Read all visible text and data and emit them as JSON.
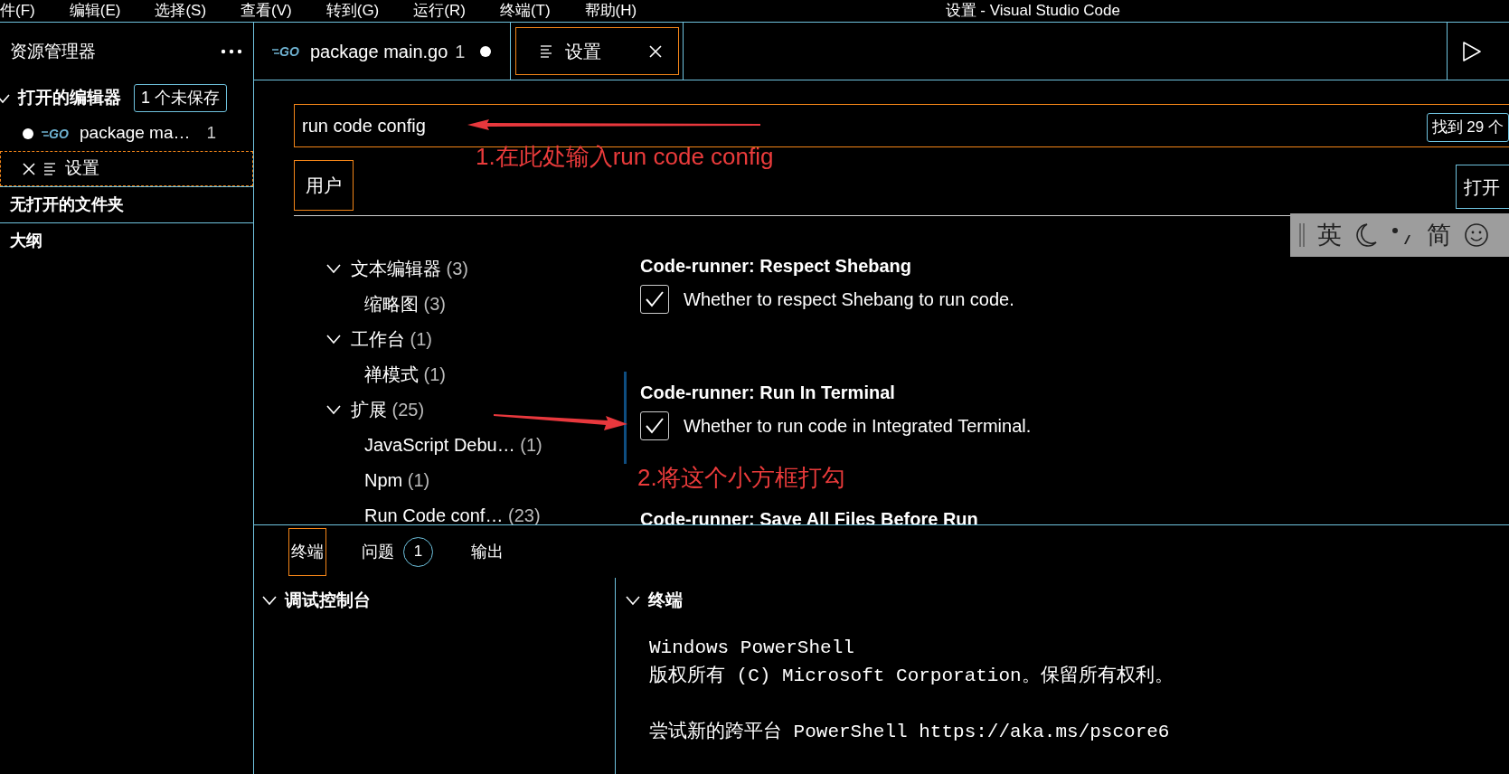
{
  "menu_bar": {
    "items": [
      "件(F)",
      "编辑(E)",
      "选择(S)",
      "查看(V)",
      "转到(G)",
      "运行(R)",
      "终端(T)",
      "帮助(H)"
    ],
    "title": "设置 - Visual Studio Code"
  },
  "sidebar": {
    "title": "资源管理器",
    "open_editors": {
      "label": "打开的编辑器",
      "expanded": true,
      "badge": "1 个未保存",
      "items": [
        {
          "kind": "go",
          "logo": "GO",
          "label": "package ma…",
          "problems": "1",
          "dirty": true,
          "selected": false
        },
        {
          "kind": "settings",
          "label": "设置",
          "dirty": false,
          "selected": true
        }
      ]
    },
    "sections": [
      {
        "label": "无打开的文件夹"
      },
      {
        "label": "大纲"
      }
    ]
  },
  "editor_tabs": [
    {
      "kind": "go",
      "logo": "GO",
      "label": "package main.go",
      "problems": "1",
      "dirty": true,
      "selected": false
    },
    {
      "kind": "settings",
      "label": "设置",
      "dirty": false,
      "selected": true
    }
  ],
  "settings": {
    "search": {
      "value": "run code config",
      "result_count": "找到 29 个"
    },
    "scopes": [
      {
        "label": "用户",
        "selected": true
      }
    ],
    "open_json_button": "打开",
    "toc": [
      {
        "label": "文本编辑器",
        "count": "(3)",
        "expanded": true,
        "children": [
          {
            "label": "缩略图",
            "count": "(3)"
          }
        ]
      },
      {
        "label": "工作台",
        "count": "(1)",
        "expanded": true,
        "children": [
          {
            "label": "禅模式",
            "count": "(1)"
          }
        ]
      },
      {
        "label": "扩展",
        "count": "(25)",
        "expanded": true,
        "children": [
          {
            "label": "JavaScript Debu…",
            "count": "(1)"
          },
          {
            "label": "Npm",
            "count": "(1)"
          },
          {
            "label": "Run Code conf…",
            "count": "(23)"
          }
        ]
      }
    ],
    "items": [
      {
        "category": "Code-runner: ",
        "name": "Respect Shebang",
        "description": "Whether to respect Shebang to run code.",
        "checked": true,
        "focused": false
      },
      {
        "category": "Code-runner: ",
        "name": "Run In Terminal",
        "description": "Whether to run code in Integrated Terminal.",
        "checked": true,
        "focused": true
      },
      {
        "category": "Code-runner: ",
        "name": "Save All Files Before Run",
        "focused": false
      }
    ]
  },
  "annotations": [
    {
      "text": "1.在此处输入run code config"
    },
    {
      "text": "2.将这个小方框打勾"
    }
  ],
  "ime_toolbar": {
    "items": [
      "英",
      "简"
    ]
  },
  "panel": {
    "tabs": [
      {
        "label": "终端",
        "selected": true
      },
      {
        "label": "问题",
        "badge": "1",
        "selected": false
      },
      {
        "label": "输出",
        "selected": false
      }
    ],
    "sections": [
      {
        "title": "调试控制台",
        "expanded": true
      },
      {
        "title": "终端",
        "expanded": true,
        "paragraphs": [
          [
            "Windows PowerShell",
            "版权所有 (C) Microsoft Corporation。保留所有权利。"
          ],
          [
            "尝试新的跨平台 PowerShell https://aka.ms/pscore6"
          ]
        ]
      }
    ]
  }
}
